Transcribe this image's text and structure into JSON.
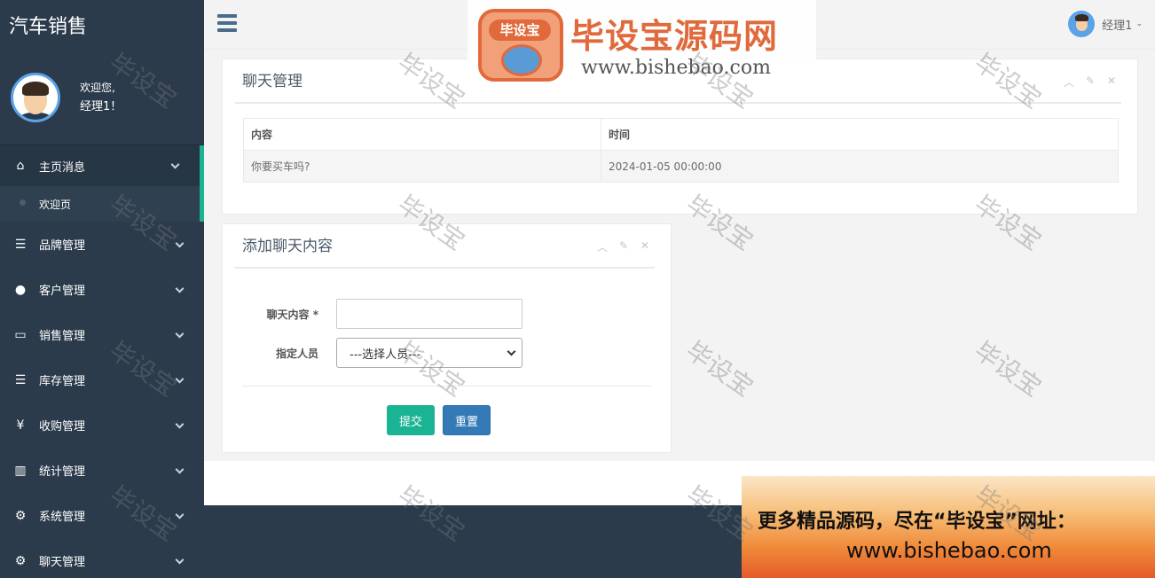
{
  "app": {
    "title": "汽车销售"
  },
  "profile": {
    "welcome": "欢迎您,",
    "username": "经理1！"
  },
  "topbar": {
    "user": "经理1"
  },
  "sidebar": {
    "items": [
      {
        "label": "主页消息",
        "icon": "home-icon",
        "active": true
      },
      {
        "label": "欢迎页",
        "sub": true
      },
      {
        "label": "品牌管理",
        "icon": "list-icon"
      },
      {
        "label": "客户管理",
        "icon": "user-icon"
      },
      {
        "label": "销售管理",
        "icon": "desktop-icon"
      },
      {
        "label": "库存管理",
        "icon": "list-icon"
      },
      {
        "label": "收购管理",
        "icon": "yen-icon"
      },
      {
        "label": "统计管理",
        "icon": "bar-chart-icon"
      },
      {
        "label": "系统管理",
        "icon": "gear-icon"
      },
      {
        "label": "聊天管理",
        "icon": "gear-icon"
      }
    ]
  },
  "chat_panel": {
    "title": "聊天管理",
    "columns": [
      "内容",
      "时间"
    ],
    "rows": [
      {
        "content": "你要买车吗?",
        "time": "2024-01-05 00:00:00"
      }
    ]
  },
  "add_panel": {
    "title": "添加聊天内容",
    "content_label": "聊天内容 *",
    "content_value": "",
    "person_label": "指定人员",
    "person_selected": "---选择人员---",
    "submit_label": "提交",
    "reset_label": "重置"
  },
  "watermark": {
    "logo_badge": "毕设宝",
    "logo_title": "毕设宝源码网",
    "logo_url": "www.bishebao.com",
    "promo_line1": "更多精品源码，尽在“毕设宝”网址：",
    "promo_line2": "www.bishebao.com",
    "tile_text": "毕设宝"
  },
  "colors": {
    "sidebar": "#2b3b4c",
    "accent": "#1ab394",
    "primary": "#337ab7"
  }
}
